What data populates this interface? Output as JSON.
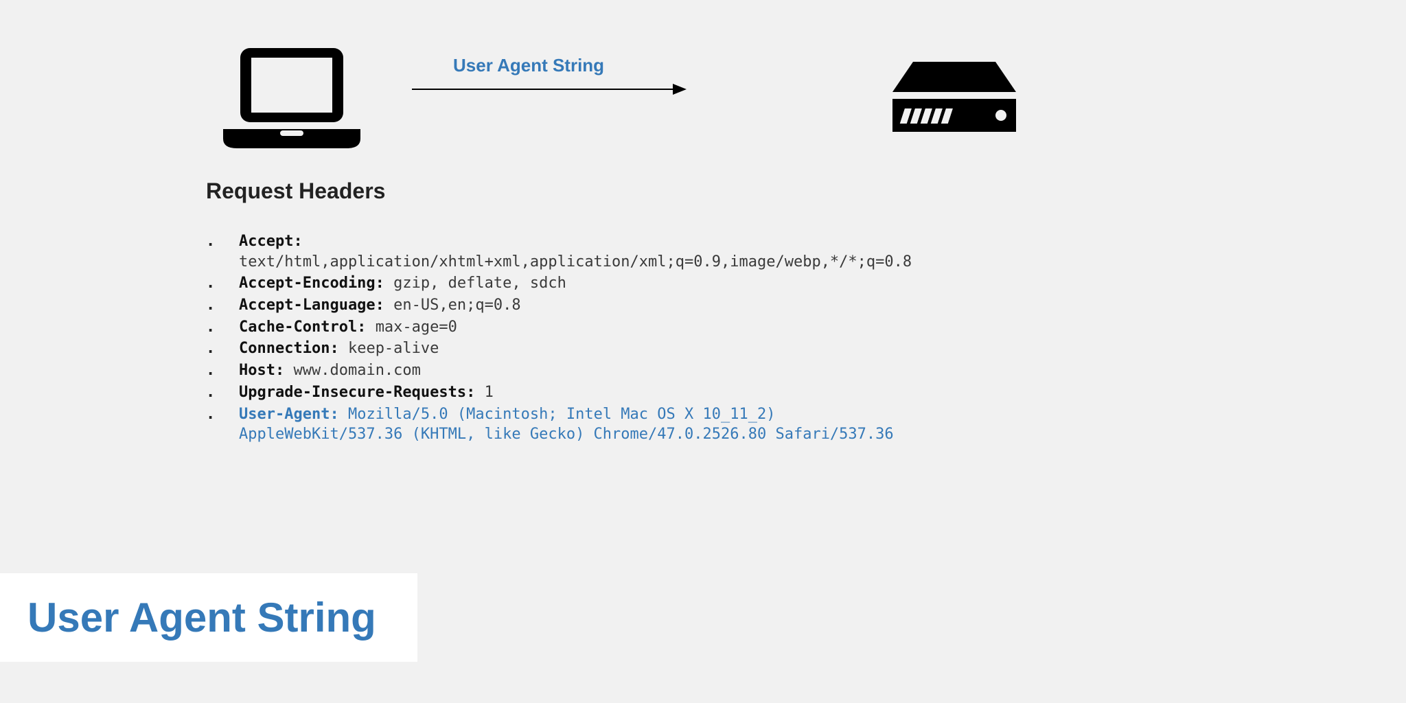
{
  "diagram": {
    "arrow_label": "User Agent String"
  },
  "section_title": "Request Headers",
  "headers": [
    {
      "name": "Accept:",
      "value": "text/html,application/xhtml+xml,application/xml;q=0.9,image/webp,*/*;q=0.8"
    },
    {
      "name": "Accept-Encoding:",
      "value": "gzip, deflate, sdch"
    },
    {
      "name": "Accept-Language:",
      "value": "en-US,en;q=0.8"
    },
    {
      "name": "Cache-Control:",
      "value": "max-age=0"
    },
    {
      "name": "Connection:",
      "value": "keep-alive"
    },
    {
      "name": "Host:",
      "value": "www.domain.com"
    },
    {
      "name": "Upgrade-Insecure-Requests:",
      "value": "1"
    },
    {
      "name": "User-Agent:",
      "value": "Mozilla/5.0 (Macintosh; Intel Mac OS X 10_11_2) AppleWebKit/537.36 (KHTML, like Gecko) Chrome/47.0.2526.80 Safari/537.36",
      "highlight": true
    }
  ],
  "title": "User Agent String",
  "colors": {
    "accent": "#3579b8"
  }
}
